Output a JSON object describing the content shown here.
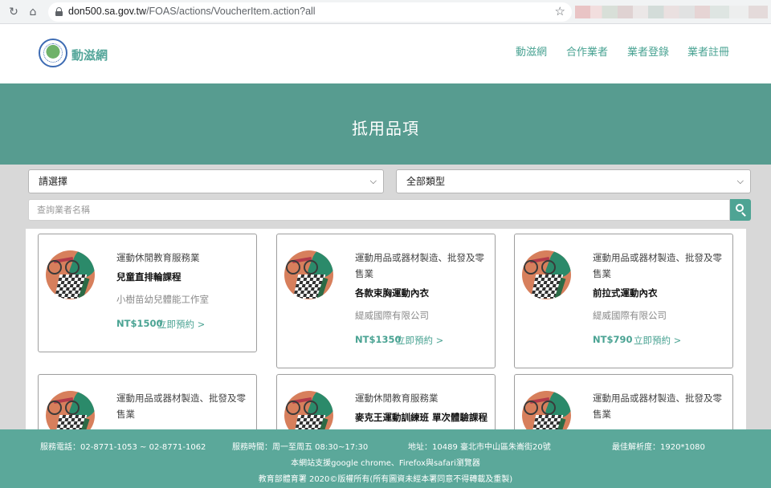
{
  "browser": {
    "url_host": "don500.sa.gov.tw",
    "url_path": "/FOAS/actions/VoucherItem.action?all"
  },
  "site": {
    "logo_text": "動滋網",
    "nav": [
      "動滋網",
      "合作業者",
      "業者登錄",
      "業者註冊"
    ]
  },
  "hero": {
    "title": "抵用品項"
  },
  "filters": {
    "city_select": "請選擇",
    "type_select": "全部類型",
    "search_placeholder": "查詢業者名稱"
  },
  "cards": [
    {
      "category": "運動休閒教育服務業",
      "name": "兒童直排輪課程",
      "vendor": "小樹苗幼兒體能工作室",
      "price": "NT$1500",
      "book": "立即預約 >"
    },
    {
      "category": "運動用品或器材製造、批發及零售業",
      "name": "各款束胸運動內衣",
      "vendor": "緹威國際有限公司",
      "price": "NT$1350",
      "book": "立即預約 >"
    },
    {
      "category": "運動用品或器材製造、批發及零售業",
      "name": "前拉式運動內衣",
      "vendor": "緹威國際有限公司",
      "price": "NT$790",
      "book": "立即預約 >"
    },
    {
      "category": "運動用品或器材製造、批發及零售業",
      "name": "",
      "vendor": "",
      "price": "",
      "book": ""
    },
    {
      "category": "運動休閒教育服務業",
      "name": "麥克王運動訓練班 單次體驗課程",
      "vendor": "",
      "price": "",
      "book": ""
    },
    {
      "category": "運動用品或器材製造、批發及零售業",
      "name": "",
      "vendor": "",
      "price": "",
      "book": ""
    }
  ],
  "footer": {
    "phone": "服務電話：02-8771-1053 ~ 02-8771-1062",
    "hours": "服務時間：周一至周五 08:30~17:30",
    "address": "地址：10489 臺北市中山區朱崙街20號",
    "resolution": "最佳解析度：1920*1080",
    "browsers": "本網站支援google chrome、Firefox與safari瀏覽器",
    "copyright": "教育部體育署 2020©版權所有(所有圖資未經本署同意不得轉載及重製)"
  }
}
